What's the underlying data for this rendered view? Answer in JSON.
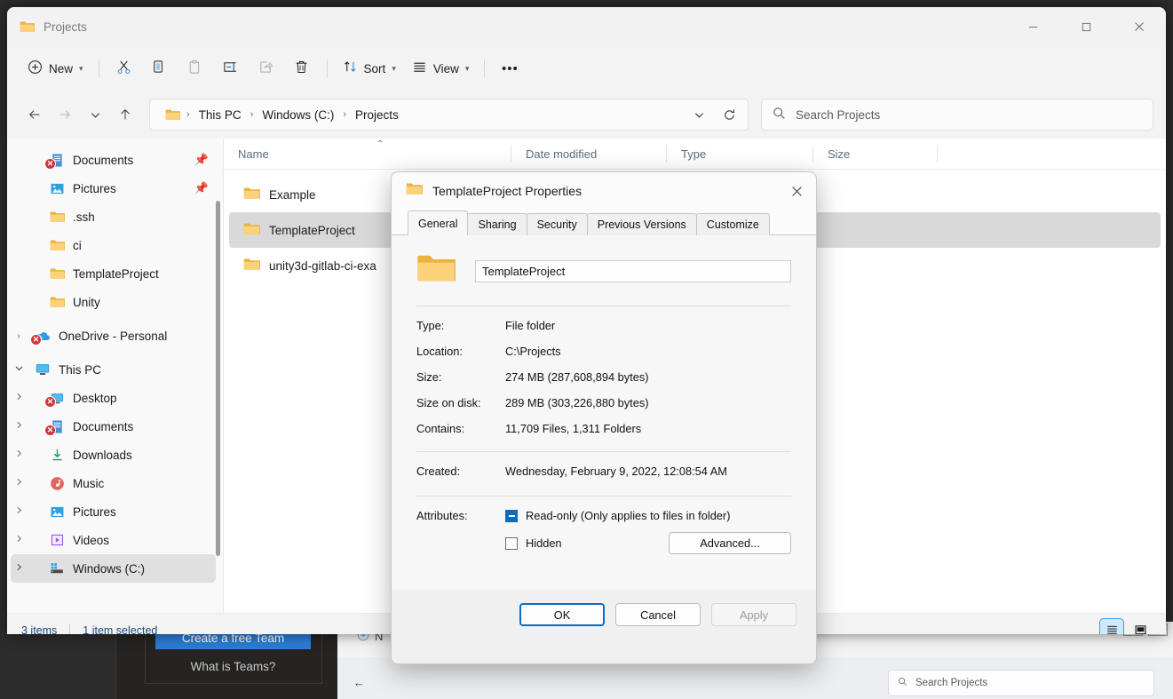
{
  "window": {
    "title": "Projects",
    "controls": {
      "minimize": "—",
      "maximize": "□",
      "close": "✕"
    }
  },
  "toolbar": {
    "new_label": "New",
    "sort_label": "Sort",
    "view_label": "View",
    "more_label": "•••",
    "icons": [
      "plus-circle-icon",
      "cut-icon",
      "copy-icon",
      "paste-icon",
      "rename-icon",
      "share-icon",
      "delete-icon",
      "sort-icon",
      "view-icon",
      "more-icon"
    ]
  },
  "address": {
    "back_arrow": "←",
    "forward_arrow": "→",
    "recent_chevron": "⌄",
    "up_arrow": "↑",
    "crumbs": [
      "This PC",
      "Windows (C:)",
      "Projects"
    ],
    "separator": "›",
    "dropdown_chevron": "⌄",
    "refresh_icon": "⟳"
  },
  "search": {
    "placeholder": "Search Projects",
    "icon": "search-icon"
  },
  "sidebar": {
    "items": [
      {
        "label": "Documents",
        "icon": "documents-icon",
        "indent": 1,
        "arrow": "",
        "pinned": true,
        "error": true,
        "selected": false
      },
      {
        "label": "Pictures",
        "icon": "pictures-icon",
        "indent": 1,
        "arrow": "",
        "pinned": true,
        "error": false,
        "selected": false
      },
      {
        "label": ".ssh",
        "icon": "folder-icon",
        "indent": 1,
        "arrow": "",
        "pinned": false,
        "error": false,
        "selected": false
      },
      {
        "label": "ci",
        "icon": "folder-icon",
        "indent": 1,
        "arrow": "",
        "pinned": false,
        "error": false,
        "selected": false
      },
      {
        "label": "TemplateProject",
        "icon": "folder-icon",
        "indent": 1,
        "arrow": "",
        "pinned": false,
        "error": false,
        "selected": false
      },
      {
        "label": "Unity",
        "icon": "folder-icon",
        "indent": 1,
        "arrow": "",
        "pinned": false,
        "error": false,
        "selected": false
      },
      {
        "label": "OneDrive - Personal",
        "icon": "onedrive-icon",
        "indent": 0,
        "arrow": "›",
        "pinned": false,
        "error": true,
        "selected": false
      },
      {
        "label": "This PC",
        "icon": "thispc-icon",
        "indent": 0,
        "arrow": "⌄",
        "pinned": false,
        "error": false,
        "selected": false
      },
      {
        "label": "Desktop",
        "icon": "desktop-icon",
        "indent": 1,
        "arrow": "›",
        "pinned": false,
        "error": true,
        "selected": false
      },
      {
        "label": "Documents",
        "icon": "documents-icon",
        "indent": 1,
        "arrow": "›",
        "pinned": false,
        "error": true,
        "selected": false
      },
      {
        "label": "Downloads",
        "icon": "downloads-icon",
        "indent": 1,
        "arrow": "›",
        "pinned": false,
        "error": false,
        "selected": false
      },
      {
        "label": "Music",
        "icon": "music-icon",
        "indent": 1,
        "arrow": "›",
        "pinned": false,
        "error": false,
        "selected": false
      },
      {
        "label": "Pictures",
        "icon": "pictures-icon",
        "indent": 1,
        "arrow": "›",
        "pinned": false,
        "error": false,
        "selected": false
      },
      {
        "label": "Videos",
        "icon": "videos-icon",
        "indent": 1,
        "arrow": "›",
        "pinned": false,
        "error": false,
        "selected": false
      },
      {
        "label": "Windows (C:)",
        "icon": "drive-icon",
        "indent": 1,
        "arrow": "›",
        "pinned": false,
        "error": false,
        "selected": true
      }
    ]
  },
  "filelist": {
    "columns": [
      "Name",
      "Date modified",
      "Type",
      "Size"
    ],
    "sort_caret": "⌃",
    "rows": [
      {
        "name": "Example",
        "selected": false
      },
      {
        "name": "TemplateProject",
        "selected": true
      },
      {
        "name": "unity3d-gitlab-ci-exa",
        "selected": false
      }
    ]
  },
  "statusbar": {
    "item_count": "3 items",
    "selection": "1 item selected",
    "view_details_icon": "details-view-icon",
    "view_large_icon": "large-icons-view-icon"
  },
  "dialog": {
    "title": "TemplateProject Properties",
    "close_icon": "✕",
    "tabs": [
      {
        "label": "General",
        "active": true
      },
      {
        "label": "Sharing",
        "active": false
      },
      {
        "label": "Security",
        "active": false
      },
      {
        "label": "Previous Versions",
        "active": false
      },
      {
        "label": "Customize",
        "active": false
      }
    ],
    "folder_name": "TemplateProject",
    "properties": [
      {
        "label": "Type:",
        "value": "File folder"
      },
      {
        "label": "Location:",
        "value": "C:\\Projects"
      },
      {
        "label": "Size:",
        "value": "274 MB (287,608,894 bytes)"
      },
      {
        "label": "Size on disk:",
        "value": "289 MB (303,226,880 bytes)"
      },
      {
        "label": "Contains:",
        "value": "11,709 Files, 1,311 Folders"
      }
    ],
    "created": {
      "label": "Created:",
      "value": "Wednesday, February 9, 2022, 12:08:54 AM"
    },
    "attributes": {
      "label": "Attributes:",
      "readonly_label": "Read-only (Only applies to files in folder)",
      "readonly_state": "indeterminate",
      "hidden_label": "Hidden",
      "hidden_state": "unchecked",
      "advanced_label": "Advanced..."
    },
    "buttons": {
      "ok": "OK",
      "cancel": "Cancel",
      "apply": "Apply"
    }
  },
  "background": {
    "teams_button": "Create a free Team",
    "teams_link": "What is Teams?",
    "explorer_new": "N",
    "explorer_search_placeholder": "Search Projects",
    "explorer_back": "←",
    "explorer_chevron": "⌄",
    "explorer_refresh": "⟳"
  },
  "colors": {
    "accent": "#0f6cbd",
    "folder": "#f7c259",
    "error_badge": "#d13438",
    "selection": "#d9d9d9",
    "teams_blue": "#2b7cd3"
  }
}
